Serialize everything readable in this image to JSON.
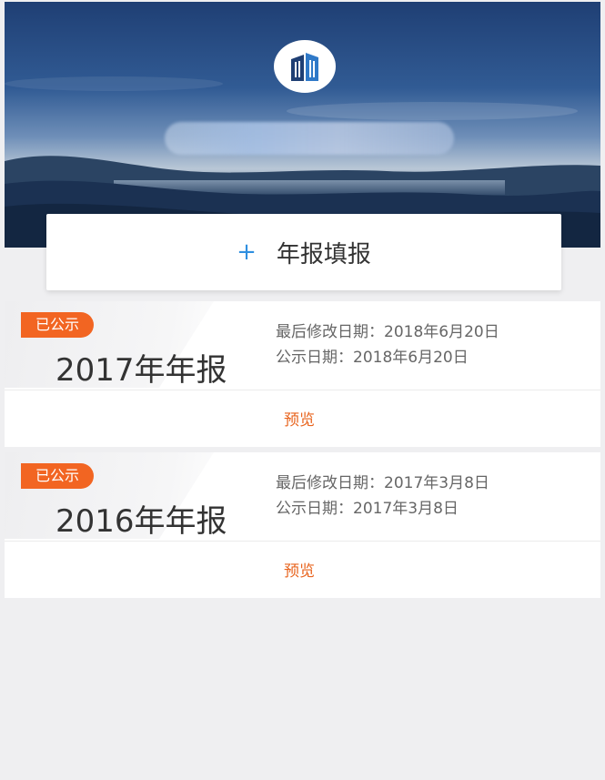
{
  "header": {
    "logo_icon": "building-icon",
    "company_name": ""
  },
  "action": {
    "plus": "+",
    "label": "年报填报"
  },
  "reports": [
    {
      "badge": "已公示",
      "title": "2017年年报",
      "last_modified": "最后修改日期：2018年6月20日",
      "publish_date": "公示日期：2018年6月20日",
      "preview": "预览"
    },
    {
      "badge": "已公示",
      "title": "2016年年报",
      "last_modified": "最后修改日期：2017年3月8日",
      "publish_date": "公示日期：2017年3月8日",
      "preview": "预览"
    }
  ],
  "colors": {
    "accent_orange": "#f26522",
    "plus_blue": "#2f8fe0"
  }
}
